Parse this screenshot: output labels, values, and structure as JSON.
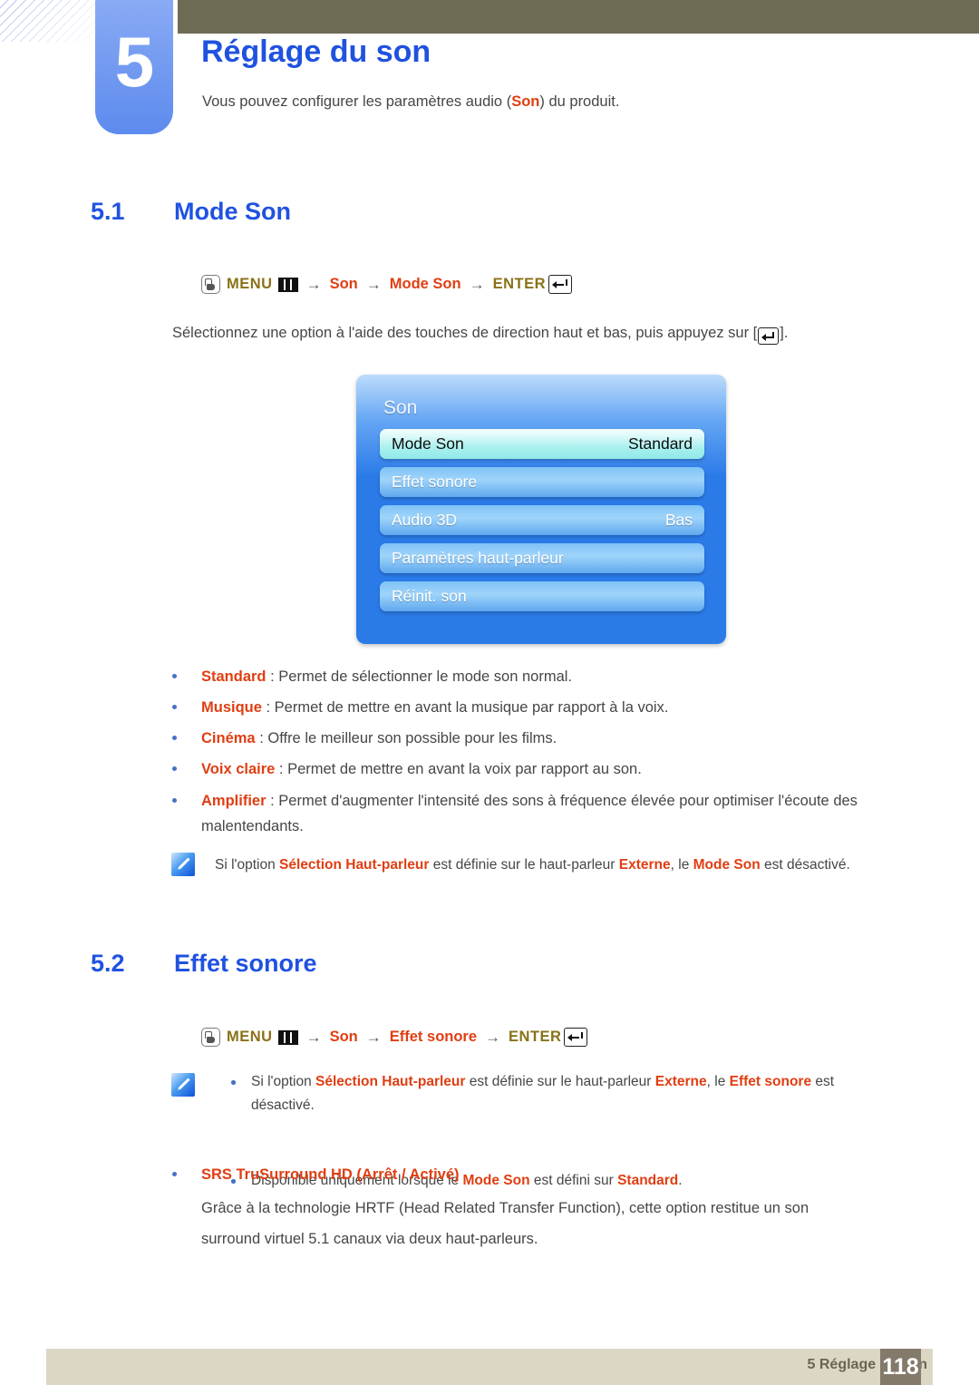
{
  "chapter": {
    "number": "5",
    "title": "Réglage du son",
    "intro_before": "Vous pouvez configurer les paramètres audio (",
    "intro_highlight": "Son",
    "intro_after": ") du produit."
  },
  "colors": {
    "heading_blue": "#2052e0",
    "highlight_orange": "#e03e12",
    "path_olive": "#8a7118",
    "olive_bar": "#6e6b55",
    "chapter_tab_blue": "#6e97f0",
    "footer_bar": "#dcd7c4",
    "footer_page_box": "#847a6c",
    "osd_background_blue": "#2a7ae8",
    "osd_selected_cyan": "#a9f0ee",
    "bullet_blue": "#4472c4"
  },
  "sections": [
    {
      "number": "5.1",
      "title": "Mode Son",
      "path": {
        "press_icon": "press-button-icon",
        "menu_label": "MENU",
        "menu_icon": "menu-bars-icon",
        "arrow": "→",
        "steps": [
          "Son",
          "Mode Son"
        ],
        "enter_label": "ENTER",
        "enter_icon": "enter-return-icon"
      },
      "instruction": "Sélectionnez une option à l'aide des touches de direction haut et bas, puis appuyez sur [",
      "instruction_after": "].",
      "osd": {
        "title": "Son",
        "rows": [
          {
            "label": "Mode Son",
            "value": "Standard",
            "selected": true
          },
          {
            "label": "Effet sonore",
            "value": "",
            "selected": false
          },
          {
            "label": "Audio 3D",
            "value": "Bas",
            "selected": false
          },
          {
            "label": "Paramètres haut-parleur",
            "value": "",
            "selected": false
          },
          {
            "label": "Réinit. son",
            "value": "",
            "selected": false
          }
        ]
      },
      "bullets": [
        {
          "term": "Standard",
          "text": " : Permet de sélectionner le mode son normal."
        },
        {
          "term": "Musique",
          "text": " : Permet de mettre en avant la musique par rapport à la voix."
        },
        {
          "term": "Cinéma",
          "text": " : Offre le meilleur son possible pour les films."
        },
        {
          "term": "Voix claire",
          "text": " : Permet de mettre en avant la voix par rapport au son."
        },
        {
          "term": "Amplifier",
          "text": " : Permet d'augmenter l'intensité des sons à fréquence élevée pour optimiser l'écoute des malentendants."
        }
      ],
      "note": {
        "icon": "note-pencil-icon",
        "parts": [
          {
            "t": "Si l'option ",
            "hl": false
          },
          {
            "t": "Sélection Haut-parleur",
            "hl": true
          },
          {
            "t": " est définie sur le haut-parleur ",
            "hl": false
          },
          {
            "t": "Externe",
            "hl": true
          },
          {
            "t": ", le ",
            "hl": false
          },
          {
            "t": "Mode Son",
            "hl": true
          },
          {
            "t": " est désactivé.",
            "hl": false
          }
        ]
      }
    },
    {
      "number": "5.2",
      "title": "Effet sonore",
      "path": {
        "press_icon": "press-button-icon",
        "menu_label": "MENU",
        "menu_icon": "menu-bars-icon",
        "arrow": "→",
        "steps": [
          "Son",
          "Effet sonore"
        ],
        "enter_label": "ENTER",
        "enter_icon": "enter-return-icon"
      },
      "note": {
        "icon": "note-pencil-icon",
        "items": [
          {
            "parts": [
              {
                "t": "Si l'option ",
                "hl": false
              },
              {
                "t": "Sélection Haut-parleur",
                "hl": true
              },
              {
                "t": " est définie sur le haut-parleur ",
                "hl": false
              },
              {
                "t": "Externe",
                "hl": true
              },
              {
                "t": ", le ",
                "hl": false
              },
              {
                "t": "Effet sonore",
                "hl": true
              },
              {
                "t": " est désactivé.",
                "hl": false
              }
            ]
          },
          {
            "parts": [
              {
                "t": "Disponible uniquement lorsque le ",
                "hl": false
              },
              {
                "t": "Mode Son",
                "hl": true
              },
              {
                "t": " est défini sur ",
                "hl": false
              },
              {
                "t": "Standard",
                "hl": true
              },
              {
                "t": ".",
                "hl": false
              }
            ]
          }
        ]
      },
      "option": {
        "term": "SRS TruSurround HD",
        "values_open": " (",
        "value_1": "Arrêt",
        "value_sep": " / ",
        "value_2": "Activé",
        "values_close": ")",
        "description": "Grâce à la technologie HRTF (Head Related Transfer Function), cette option restitue un son surround virtuel 5.1 canaux via deux haut-parleurs."
      }
    }
  ],
  "footer": {
    "label": "5 Réglage du son",
    "page": "118"
  }
}
